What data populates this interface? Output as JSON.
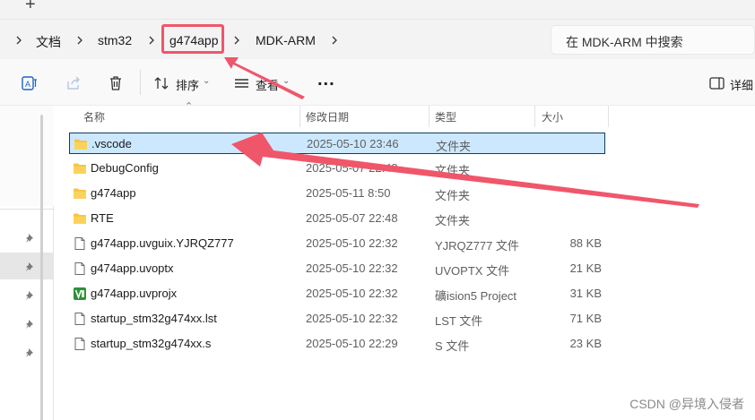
{
  "tabstrip": {
    "new_tab_glyph": "+"
  },
  "breadcrumb": {
    "items": [
      "文档",
      "stm32",
      "g474app",
      "MDK-ARM"
    ]
  },
  "search": {
    "placeholder": "在 MDK-ARM 中搜索"
  },
  "toolbar": {
    "sort_label": "排序",
    "view_label": "查看",
    "more_label": "...",
    "details_label": "详细"
  },
  "columns": {
    "name": "名称",
    "date": "修改日期",
    "type": "类型",
    "size": "大小"
  },
  "files": [
    {
      "name": ".vscode",
      "date": "2025-05-10 23:46",
      "type": "文件夹",
      "size": "",
      "icon": "folder-icon",
      "selected": true
    },
    {
      "name": "DebugConfig",
      "date": "2025-05-07 22:48",
      "type": "文件夹",
      "size": "",
      "icon": "folder-icon",
      "selected": false
    },
    {
      "name": "g474app",
      "date": "2025-05-11 8:50",
      "type": "文件夹",
      "size": "",
      "icon": "folder-icon",
      "selected": false
    },
    {
      "name": "RTE",
      "date": "2025-05-07 22:48",
      "type": "文件夹",
      "size": "",
      "icon": "folder-icon",
      "selected": false
    },
    {
      "name": "g474app.uvguix.YJRQZ777",
      "date": "2025-05-10 22:32",
      "type": "YJRQZ777 文件",
      "size": "88 KB",
      "icon": "file-icon",
      "selected": false
    },
    {
      "name": "g474app.uvoptx",
      "date": "2025-05-10 22:32",
      "type": "UVOPTX 文件",
      "size": "21 KB",
      "icon": "file-icon",
      "selected": false
    },
    {
      "name": "g474app.uvprojx",
      "date": "2025-05-10 22:32",
      "type": "礦ision5 Project",
      "size": "31 KB",
      "icon": "keil-project-icon",
      "selected": false
    },
    {
      "name": "startup_stm32g474xx.lst",
      "date": "2025-05-10 22:32",
      "type": "LST 文件",
      "size": "71 KB",
      "icon": "file-icon",
      "selected": false
    },
    {
      "name": "startup_stm32g474xx.s",
      "date": "2025-05-10 22:29",
      "type": "S 文件",
      "size": "23 KB",
      "icon": "file-icon",
      "selected": false
    }
  ],
  "watermark": "CSDN @异境入侵者",
  "colors": {
    "annotation": "#f0566a",
    "selection_bg": "#cce8ff",
    "selection_border": "#0a3c6a",
    "folder": "#f8c542"
  }
}
